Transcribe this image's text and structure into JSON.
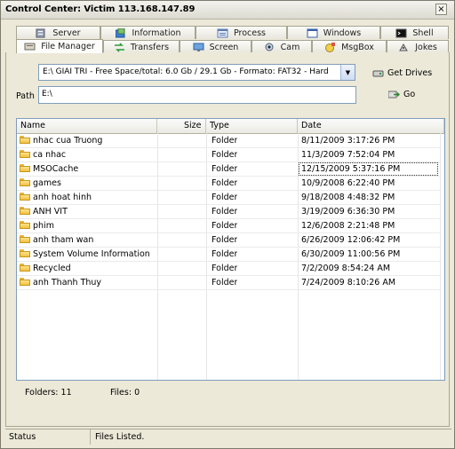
{
  "window": {
    "title": "Control Center: Victim 113.168.147.89",
    "close_label": "×"
  },
  "tabs_row1": [
    {
      "label": "Server",
      "icon": "server-icon"
    },
    {
      "label": "Information",
      "icon": "information-icon"
    },
    {
      "label": "Process",
      "icon": "process-icon"
    },
    {
      "label": "Windows",
      "icon": "windows-icon"
    },
    {
      "label": "Shell",
      "icon": "shell-icon"
    }
  ],
  "tabs_row2": [
    {
      "label": "File Manager",
      "icon": "file-manager-icon",
      "active": true
    },
    {
      "label": "Transfers",
      "icon": "transfers-icon"
    },
    {
      "label": "Screen",
      "icon": "screen-icon"
    },
    {
      "label": "Cam",
      "icon": "cam-icon"
    },
    {
      "label": "MsgBox",
      "icon": "msgbox-icon"
    },
    {
      "label": "Jokes",
      "icon": "jokes-icon"
    }
  ],
  "drive_select": {
    "value": "E:\\ GIAI TRI - Free Space/total: 6.0 Gb / 29.1 Gb - Formato: FAT32 - Hard"
  },
  "get_drives_label": "Get Drives",
  "path": {
    "label": "Path",
    "value": "E:\\"
  },
  "go_label": "Go",
  "table": {
    "columns": [
      "Name",
      "Size",
      "Type",
      "Date"
    ],
    "rows": [
      {
        "name": "nhac cua Truong",
        "size": "",
        "type": "Folder",
        "date": "8/11/2009 3:17:26 PM"
      },
      {
        "name": "ca nhac",
        "size": "",
        "type": "Folder",
        "date": "11/3/2009 7:52:04 PM"
      },
      {
        "name": "MSOCache",
        "size": "",
        "type": "Folder",
        "date": "12/15/2009 5:37:16 PM"
      },
      {
        "name": "games",
        "size": "",
        "type": "Folder",
        "date": "10/9/2008 6:22:40 PM"
      },
      {
        "name": "anh hoat hinh",
        "size": "",
        "type": "Folder",
        "date": "9/18/2008 4:48:32 PM"
      },
      {
        "name": "ANH VIT",
        "size": "",
        "type": "Folder",
        "date": "3/19/2009 6:36:30 PM"
      },
      {
        "name": "phim",
        "size": "",
        "type": "Folder",
        "date": "12/6/2008 2:21:48 PM"
      },
      {
        "name": "anh tham wan",
        "size": "",
        "type": "Folder",
        "date": "6/26/2009 12:06:42 PM"
      },
      {
        "name": "System Volume Information",
        "size": "",
        "type": "Folder",
        "date": "6/30/2009 11:00:56 PM"
      },
      {
        "name": "Recycled",
        "size": "",
        "type": "Folder",
        "date": "7/2/2009 8:54:24 AM"
      },
      {
        "name": "anh Thanh Thuy",
        "size": "",
        "type": "Folder",
        "date": "7/24/2009 8:10:26 AM"
      }
    ]
  },
  "counts": {
    "folders": "Folders: 11",
    "files": "Files: 0"
  },
  "statusbar": {
    "label": "Status",
    "text": "Files Listed."
  }
}
